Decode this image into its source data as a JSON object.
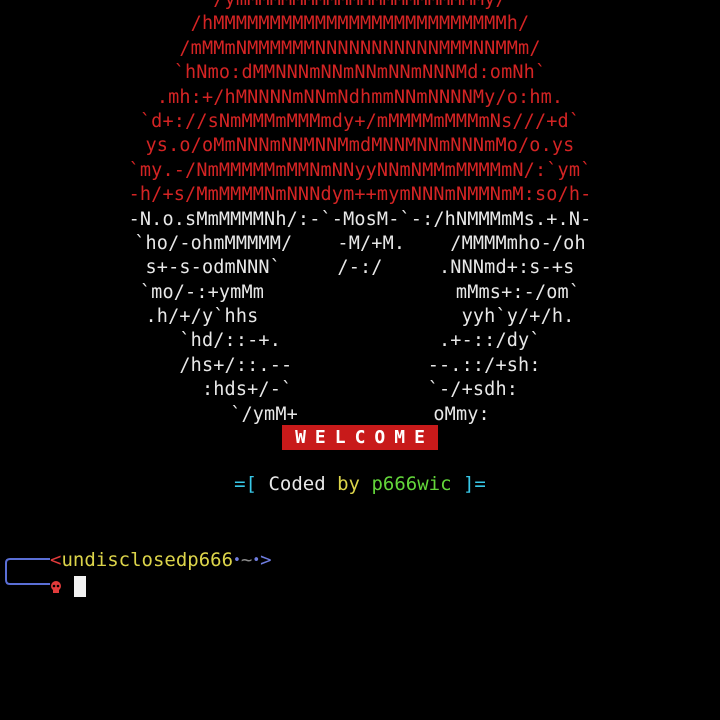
{
  "art": {
    "red_lines": [
      "/ymMMMMMMMMMMMMMMMMMMMMMy/",
      "/hMMMMMMMMMMMMMMMMMMMMMMMMMMh/",
      "/mMMmNMMMMMMNNNNNNNNNNNMMMNNMMm/",
      "`hNmo:dMMNNNmNNmNNmNNmNNNMd:omNh`",
      ".mh:+/hMNNNNmNNmNdhmmNNmNNNNMy/o:hm.",
      "`d+://sNmMMMmMMMmdy+/mMMMMmMMMmNs///+d`",
      "ys.o/oMmNNNmNNMNNMmdMNNMNNmNNNmMo/o.ys",
      "`my.-/NmMMMMMmMMNmNNyyNNmNMMmMMMMmN/:`ym`",
      "-h/+s/MmMMMMNmNNNdym++mymNNNmNMMNmM:so/h-"
    ],
    "white_lines": [
      "-N.o.sMmMMMMNh/:-`-MosM-`-:/hNMMMmMs.+.N-",
      "`ho/-ohmMMMMM/    -M/+M.    /MMMMmho-/oh",
      "s+-s-odmNNN`     /-:/     .NNNmd+:s-+s",
      "`mo/-:+ymMm                 mMms+:-/om`",
      ".h/+/y`hhs                  yyh`y/+/h.",
      "`hd/::-+.              .+-::/dy`",
      "/hs+/::.--            --.::/+sh:",
      ":hds+/-`            `-/+sdh:",
      "`/ymM+            oMmy:"
    ]
  },
  "banner": {
    "text": "WELCOME"
  },
  "credit": {
    "open": "=[",
    "coded": "Coded",
    "by": "by",
    "author": "p666wic",
    "close": "]="
  },
  "prompt": {
    "lt": "<",
    "user": "undisclosedp666",
    "dot1": "•",
    "tilde": "~",
    "dot2": "•",
    "gt": ">"
  },
  "colors": {
    "background": "#000000",
    "art_red": "#d42424",
    "banner_bg": "#c81a1a",
    "cyan": "#38c8e8",
    "yellow": "#dcd44a",
    "green": "#63d63a",
    "prompt_frame": "#5b6fd6"
  }
}
